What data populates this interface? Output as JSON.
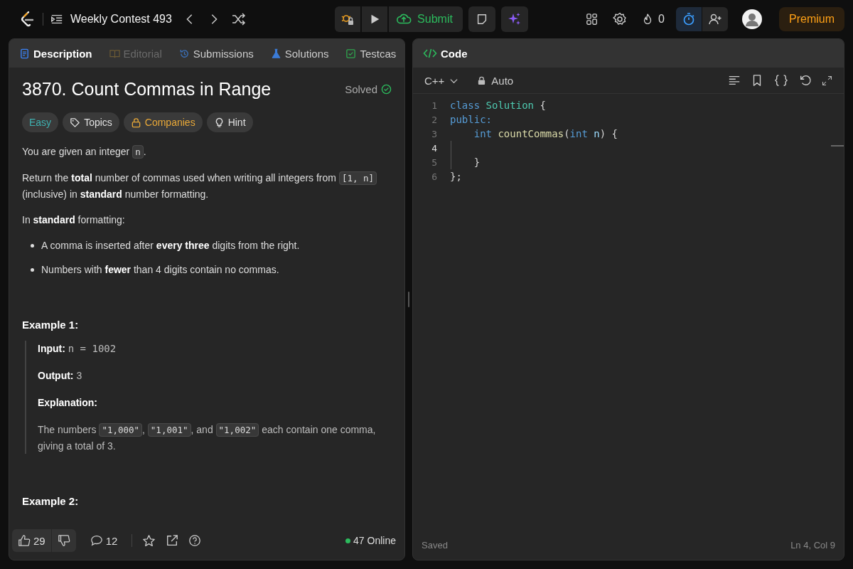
{
  "topbar": {
    "title": "Weekly Contest 493",
    "submit": "Submit",
    "streak": "0",
    "premium": "Premium",
    "timer_on": true
  },
  "left_tabs": [
    {
      "label": "Description",
      "selected": true,
      "disabled": false,
      "kind": "description"
    },
    {
      "label": "Editorial",
      "selected": false,
      "disabled": true,
      "kind": "editorial"
    },
    {
      "label": "Submissions",
      "selected": false,
      "disabled": false,
      "kind": "submissions"
    },
    {
      "label": "Solutions",
      "selected": false,
      "disabled": false,
      "kind": "solutions"
    },
    {
      "label": "Testcas",
      "selected": false,
      "disabled": false,
      "kind": "testcase"
    }
  ],
  "problem": {
    "title": "3870. Count Commas in Range",
    "status": "Solved",
    "difficulty": "Easy",
    "chips": [
      {
        "kind": "topics",
        "label": "Topics"
      },
      {
        "kind": "companies",
        "label": "Companies"
      },
      {
        "kind": "hint",
        "label": "Hint"
      }
    ],
    "content": [
      {
        "kind": "paragraph",
        "segments": [
          {
            "kind": "text",
            "text": "You are given an integer "
          },
          {
            "kind": "code",
            "text": "n"
          },
          {
            "kind": "text",
            "text": "."
          }
        ]
      },
      {
        "kind": "paragraph",
        "segments": [
          {
            "kind": "text",
            "text": "Return the **total** number of commas used when writing all integers from "
          },
          {
            "kind": "code",
            "text": "[1, n]"
          },
          {
            "kind": "text",
            "text": " (inclusive) in **standard** number formatting."
          }
        ]
      },
      {
        "kind": "paragraph",
        "segments": [
          {
            "kind": "text",
            "text": "In **standard** formatting:"
          }
        ]
      },
      {
        "kind": "bullets",
        "items": [
          "A comma is inserted after **every three** digits from the right.",
          "Numbers with **fewer** than 4 digits contain no commas."
        ]
      },
      {
        "kind": "heading",
        "text": "Example 1:"
      },
      {
        "kind": "example",
        "lines": [
          [
            {
              "kind": "text",
              "text": "**Input:** "
            },
            {
              "kind": "mono",
              "text": "n = 1002"
            }
          ],
          [
            {
              "kind": "text",
              "text": "**Output:** 3"
            }
          ],
          [
            {
              "kind": "text",
              "text": "**Explanation:**"
            }
          ],
          [
            {
              "kind": "text",
              "text": "The numbers "
            },
            {
              "kind": "code",
              "text": "\"1,000\""
            },
            {
              "kind": "text",
              "text": ", "
            },
            {
              "kind": "code",
              "text": "\"1,001\""
            },
            {
              "kind": "text",
              "text": ", and "
            },
            {
              "kind": "code",
              "text": "\"1,002\""
            },
            {
              "kind": "text",
              "text": " each contain one comma, giving a total of 3."
            }
          ]
        ]
      },
      {
        "kind": "heading",
        "text": "Example 2:"
      }
    ]
  },
  "footer": {
    "likes": "29",
    "comments": "12",
    "online": "47 Online"
  },
  "editor": {
    "tab": "Code",
    "language": "C++",
    "mode": "Auto",
    "lines": [
      {
        "number": "1",
        "current": false,
        "tokens": [
          {
            "kind": "keyword",
            "text": "class "
          },
          {
            "kind": "type",
            "text": "Solution"
          },
          {
            "kind": "plain",
            "text": " {"
          }
        ]
      },
      {
        "number": "2",
        "current": false,
        "tokens": [
          {
            "kind": "keyword",
            "text": "public:"
          }
        ]
      },
      {
        "number": "3",
        "current": false,
        "tokens": [
          {
            "kind": "keyword",
            "text": "    int "
          },
          {
            "kind": "func",
            "text": "countCommas"
          },
          {
            "kind": "plain",
            "text": "("
          },
          {
            "kind": "keyword",
            "text": "int "
          },
          {
            "kind": "param",
            "text": "n"
          },
          {
            "kind": "plain",
            "text": ") {"
          }
        ]
      },
      {
        "number": "4",
        "current": true
      },
      {
        "number": "5",
        "current": false,
        "tokens": [
          {
            "kind": "plain",
            "text": "    }"
          }
        ]
      },
      {
        "number": "6",
        "current": false,
        "tokens": [
          {
            "kind": "plain",
            "text": "};"
          }
        ]
      }
    ],
    "status": "Saved",
    "cursor": "Ln 4, Col 9"
  }
}
